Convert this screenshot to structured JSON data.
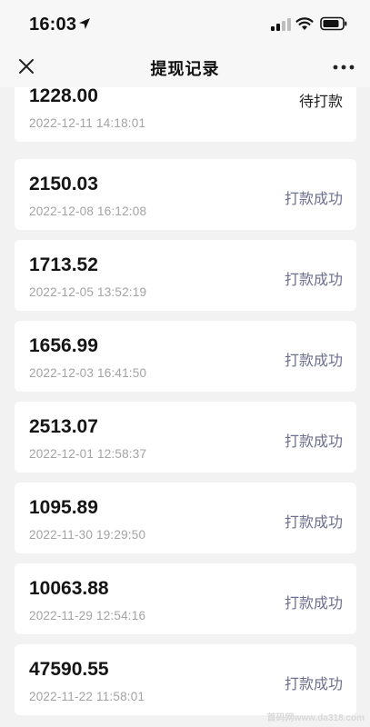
{
  "status_bar": {
    "time": "16:03",
    "icons": [
      "location-arrow-icon",
      "cellular-signal-icon",
      "wifi-icon",
      "battery-icon"
    ]
  },
  "nav": {
    "title": "提现记录",
    "left_icon": "close-icon",
    "right_icon": "more-icon"
  },
  "records": [
    {
      "amount": "1228.00",
      "datetime": "2022-12-11 14:18:01",
      "status": "待打款"
    },
    {
      "amount": "2150.03",
      "datetime": "2022-12-08 16:12:08",
      "status": "打款成功"
    },
    {
      "amount": "1713.52",
      "datetime": "2022-12-05 13:52:19",
      "status": "打款成功"
    },
    {
      "amount": "1656.99",
      "datetime": "2022-12-03 16:41:50",
      "status": "打款成功"
    },
    {
      "amount": "2513.07",
      "datetime": "2022-12-01 12:58:37",
      "status": "打款成功"
    },
    {
      "amount": "1095.89",
      "datetime": "2022-11-30 19:29:50",
      "status": "打款成功"
    },
    {
      "amount": "10063.88",
      "datetime": "2022-11-29 12:54:16",
      "status": "打款成功"
    },
    {
      "amount": "47590.55",
      "datetime": "2022-11-22 11:58:01",
      "status": "打款成功"
    }
  ],
  "colors": {
    "background": "#f2f2f2",
    "card": "#ffffff",
    "success_status": "#6d6f8e",
    "date_text": "#a3a3a3"
  },
  "watermark": "首码网www.da318.com"
}
